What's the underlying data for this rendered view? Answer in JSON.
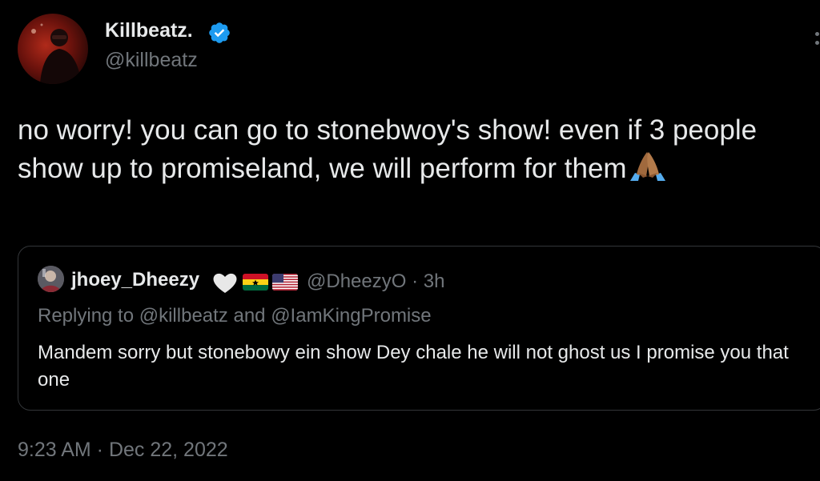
{
  "author": {
    "display_name": "Killbeatz.",
    "handle": "@killbeatz",
    "verified": true,
    "verified_icon": "verified-badge-icon",
    "avatar_icon": "profile-avatar"
  },
  "tweet": {
    "text": "no worry! you can go to stonebwoy's show! even if 3 people show up to promiseland, we will perform for them",
    "emoji": "folded-hands-icon",
    "timestamp": "9:23 AM · Dec 22, 2022"
  },
  "quoted_tweet": {
    "display_name": "jhoey_Dheezy",
    "name_icons": [
      "white-heart-icon",
      "ghana-flag-icon",
      "us-flag-icon"
    ],
    "handle_time": "@DheezyO · 3h",
    "replying_to": "Replying to @killbeatz and @IamKingPromise",
    "text": "Mandem sorry but stonebowy ein show Dey chale he will not ghost us I promise you that one"
  },
  "colors": {
    "background": "#000000",
    "primary_text": "#e7e9ea",
    "secondary_text": "#71767b",
    "verified_blue": "#1d9bf0",
    "border": "#333639"
  }
}
